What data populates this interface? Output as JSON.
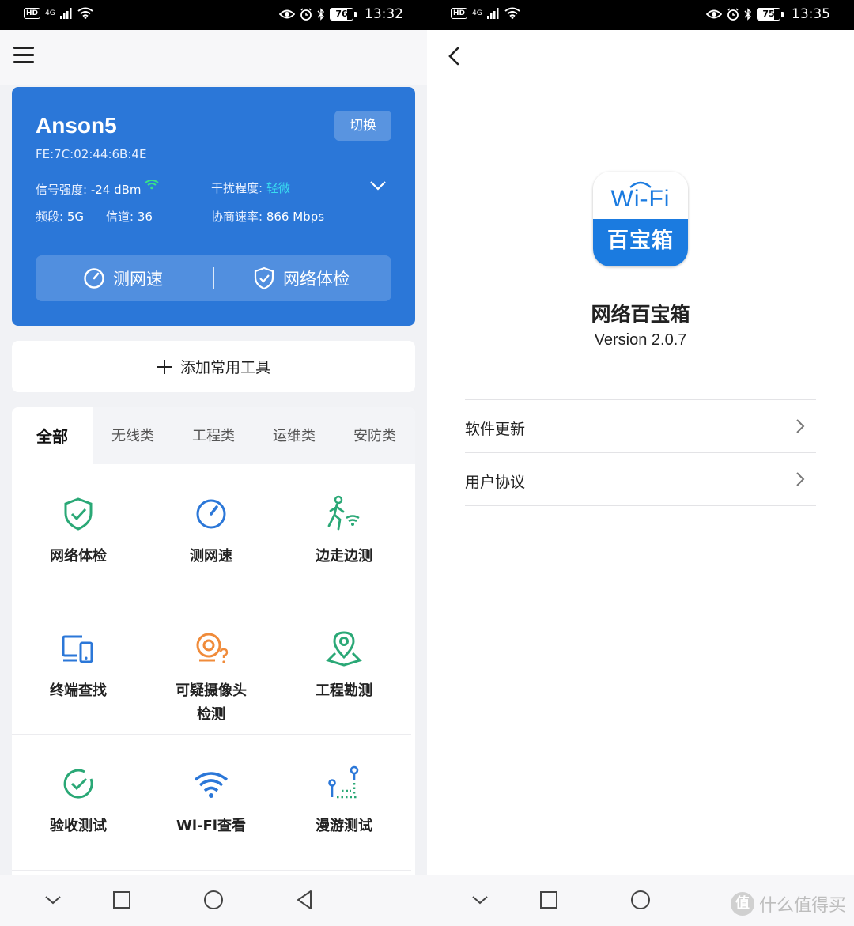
{
  "left_phone": {
    "status_bar": {
      "hd": "HD",
      "network": "4G",
      "battery": "76",
      "battery_level": 0.76,
      "time": "13:32"
    },
    "wifi_card": {
      "ssid": "Anson5",
      "mac": "FE:7C:02:44:6B:4E",
      "switch_label": "切换",
      "signal_label": "信号强度:",
      "signal_value": "-24 dBm",
      "interference_label": "干扰程度:",
      "interference_value": "轻微",
      "band_label": "频段:",
      "band_value": "5G",
      "channel_label": "信道:",
      "channel_value": "36",
      "rate_label": "协商速率:",
      "rate_value": "866 Mbps",
      "speed_test_label": "测网速",
      "health_check_label": "网络体检"
    },
    "add_tools_label": "添加常用工具",
    "tabs": [
      "全部",
      "无线类",
      "工程类",
      "运维类",
      "安防类"
    ],
    "tools": [
      {
        "label": "网络体检",
        "icon": "shield-check-icon"
      },
      {
        "label": "测网速",
        "icon": "speedometer-icon"
      },
      {
        "label": "边走边测",
        "icon": "walk-wifi-icon"
      },
      {
        "label": "终端查找",
        "icon": "devices-icon"
      },
      {
        "label": "可疑摄像头",
        "label2": "检测",
        "icon": "camera-question-icon"
      },
      {
        "label": "工程勘测",
        "icon": "map-pin-icon"
      },
      {
        "label": "验收测试",
        "icon": "check-circle-icon"
      },
      {
        "label": "Wi-Fi查看",
        "icon": "wifi-icon"
      },
      {
        "label": "漫游测试",
        "icon": "roaming-icon"
      }
    ],
    "colors": {
      "card_blue": "#2b77d8",
      "green": "#2aa876",
      "blue": "#2b77d8",
      "orange": "#f08b3a",
      "cyan": "#39dcf0"
    }
  },
  "right_phone": {
    "status_bar": {
      "hd": "HD",
      "network": "4G",
      "battery": "75",
      "battery_level": 0.75,
      "time": "13:35"
    },
    "icon_wifi_text": "Wi-Fi",
    "icon_cn_text": "百宝箱",
    "app_name": "网络百宝箱",
    "version": "Version 2.0.7",
    "menu": [
      {
        "label": "软件更新"
      },
      {
        "label": "用户协议"
      }
    ],
    "watermark": {
      "badge": "值",
      "text": "什么值得买"
    }
  }
}
